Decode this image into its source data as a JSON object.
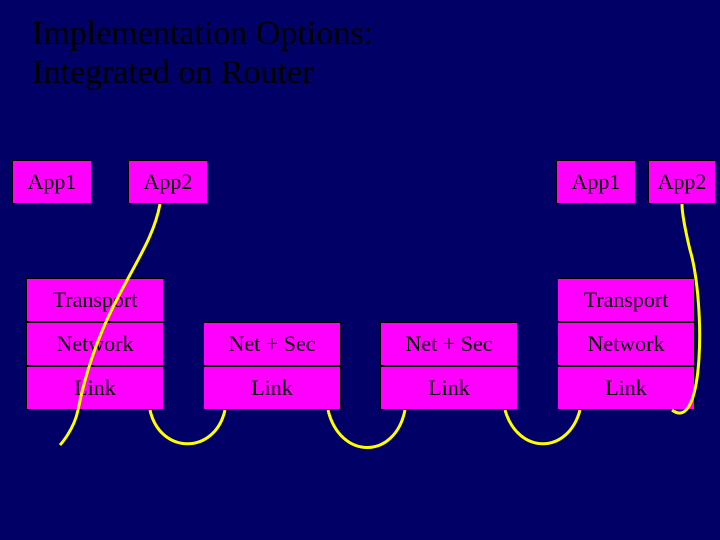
{
  "title_line1": "Implementation Options:",
  "title_line2": "Integrated on Router",
  "hostA": {
    "app1": "App1",
    "app2": "App2",
    "transport": "Transport",
    "network": "Network",
    "link": "Link"
  },
  "router1": {
    "netsec": "Net + Sec",
    "link": "Link"
  },
  "router2": {
    "netsec": "Net + Sec",
    "link": "Link"
  },
  "hostB": {
    "app1": "App1",
    "app2": "App2",
    "transport": "Transport",
    "network": "Network",
    "link": "Link"
  },
  "colors": {
    "bg": "#000066",
    "box": "#ff00ff",
    "cable": "#ffff00"
  }
}
